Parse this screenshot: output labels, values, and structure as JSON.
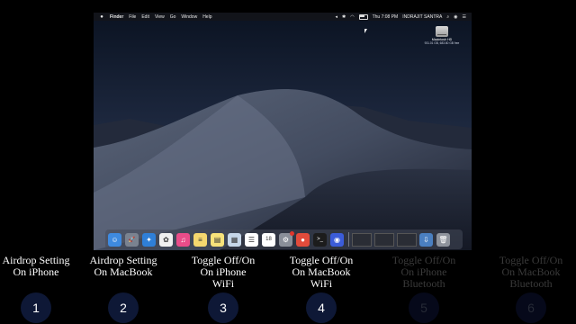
{
  "menubar": {
    "apple": "",
    "items": [
      "Finder",
      "File",
      "Edit",
      "View",
      "Go",
      "Window",
      "Help"
    ],
    "clock": "Thu 7:08 PM",
    "user": "INDRAJIT SANTRA"
  },
  "desktop": {
    "disk_label": "Macintosh HD",
    "disk_sublabel": "931.01 GB, 683.80 GB free"
  },
  "dock": {
    "apps": [
      {
        "name": "finder-icon",
        "color": "#3e8ae0",
        "glyph": "☺"
      },
      {
        "name": "launchpad-icon",
        "color": "#7a8290",
        "glyph": "🚀"
      },
      {
        "name": "safari-icon",
        "color": "#2f7fd8",
        "glyph": "✦"
      },
      {
        "name": "photos-icon",
        "color": "#f0f0f0",
        "glyph": "✿"
      },
      {
        "name": "itunes-icon",
        "color": "#ea4c89",
        "glyph": "♫"
      },
      {
        "name": "notes-icon",
        "color": "#f5d76e",
        "glyph": "≡"
      },
      {
        "name": "stickies-icon",
        "color": "#f7e27a",
        "glyph": "▤"
      },
      {
        "name": "preview-icon",
        "color": "#c6d6e8",
        "glyph": "▦"
      },
      {
        "name": "reminders-icon",
        "color": "#ffffff",
        "glyph": "☰"
      },
      {
        "name": "calendar-icon",
        "color": "#ffffff",
        "glyph": "18"
      },
      {
        "name": "system-preferences-icon",
        "color": "#8a8f99",
        "glyph": "⚙"
      },
      {
        "name": "chrome-icon",
        "color": "#e24b3b",
        "glyph": "●"
      },
      {
        "name": "terminal-icon",
        "color": "#1c1c1c",
        "glyph": ">_"
      },
      {
        "name": "siri-icon",
        "color": "#3b5cd9",
        "glyph": "◉"
      }
    ]
  },
  "steps": [
    {
      "caption": "Airdrop Setting\nOn iPhone",
      "number": "1"
    },
    {
      "caption": "Airdrop Setting\nOn MacBook",
      "number": "2"
    },
    {
      "caption": "Toggle Off/On\nOn iPhone\nWiFi",
      "number": "3"
    },
    {
      "caption": "Toggle Off/On\nOn MacBook\nWiFi",
      "number": "4"
    },
    {
      "caption": "Toggle Off/On\nOn iPhone\nBluetooth",
      "number": "5"
    },
    {
      "caption": "Toggle Off/On\nOn MacBook\nBluetooth",
      "number": "6"
    }
  ]
}
